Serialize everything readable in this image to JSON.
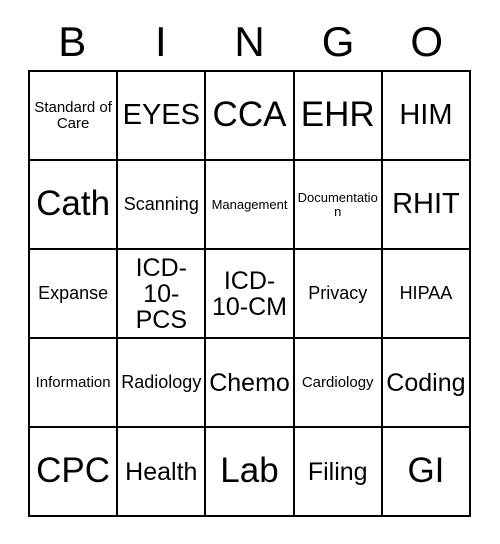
{
  "card": {
    "title_letters": [
      "B",
      "I",
      "N",
      "G",
      "O"
    ],
    "columns": 5,
    "rows": 5,
    "border_color": "#000000",
    "background_color": "#ffffff",
    "text_color": "#000000",
    "cells": [
      [
        {
          "label": "Standard of Care",
          "size": "xs"
        },
        {
          "label": "EYES",
          "size": "lg"
        },
        {
          "label": "CCA",
          "size": "xl"
        },
        {
          "label": "EHR",
          "size": "xl"
        },
        {
          "label": "HIM",
          "size": "lg"
        }
      ],
      [
        {
          "label": "Cath",
          "size": "xl"
        },
        {
          "label": "Scanning",
          "size": "sm"
        },
        {
          "label": "Management",
          "size": "xxs"
        },
        {
          "label": "Documentation",
          "size": "xxs"
        },
        {
          "label": "RHIT",
          "size": "lg"
        }
      ],
      [
        {
          "label": "Expanse",
          "size": "sm"
        },
        {
          "label": "ICD-10-PCS",
          "size": "md"
        },
        {
          "label": "ICD-10-CM",
          "size": "md"
        },
        {
          "label": "Privacy",
          "size": "sm"
        },
        {
          "label": "HIPAA",
          "size": "sm"
        }
      ],
      [
        {
          "label": "Information",
          "size": "xs"
        },
        {
          "label": "Radiology",
          "size": "sm"
        },
        {
          "label": "Chemo",
          "size": "md"
        },
        {
          "label": "Cardiology",
          "size": "xs"
        },
        {
          "label": "Coding",
          "size": "md"
        }
      ],
      [
        {
          "label": "CPC",
          "size": "xl"
        },
        {
          "label": "Health",
          "size": "md"
        },
        {
          "label": "Lab",
          "size": "xl"
        },
        {
          "label": "Filing",
          "size": "md"
        },
        {
          "label": "GI",
          "size": "xl"
        }
      ]
    ]
  }
}
